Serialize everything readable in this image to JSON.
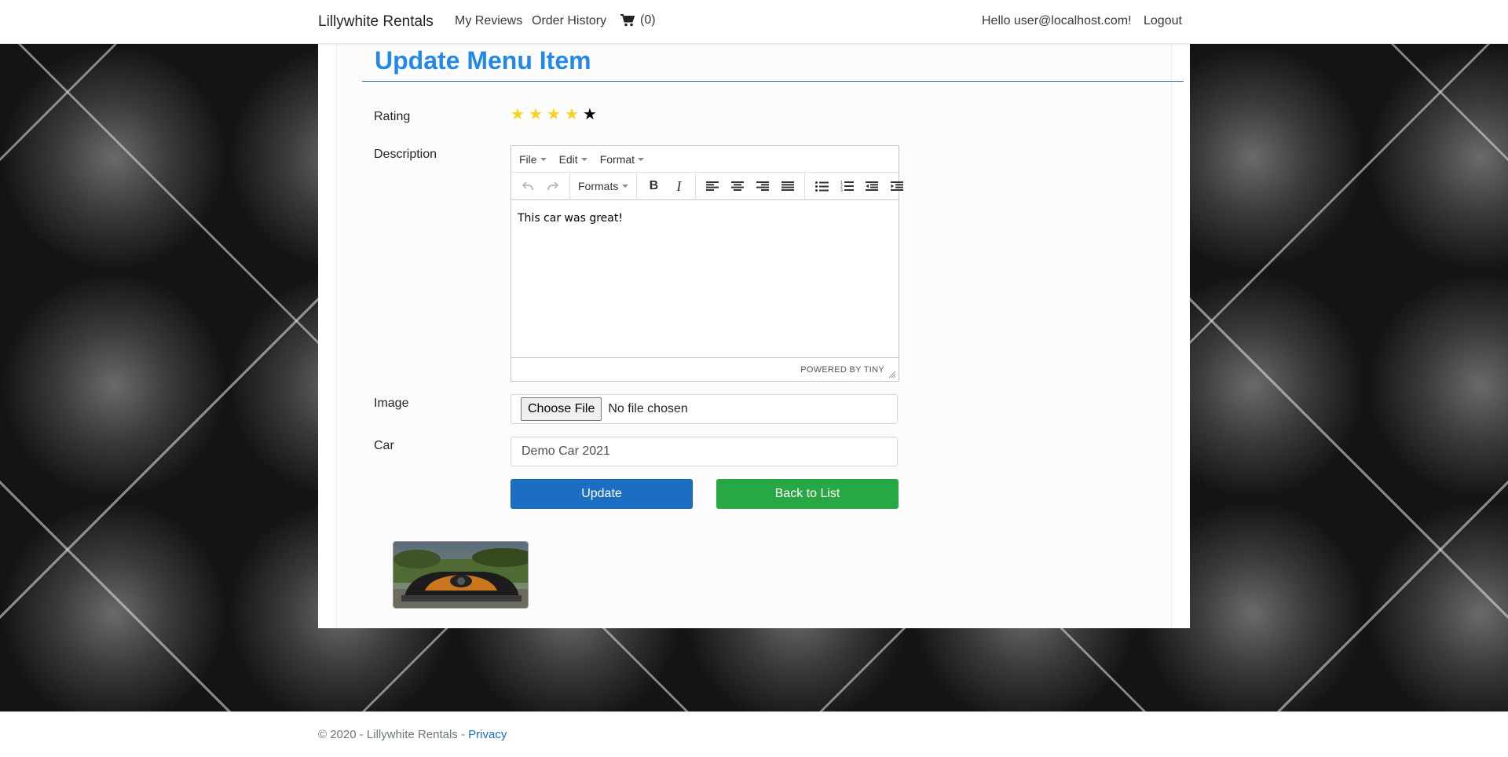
{
  "navbar": {
    "brand": "Lillywhite Rentals",
    "my_reviews": "My Reviews",
    "order_history": "Order History",
    "cart_count": "(0)",
    "greeting": "Hello user@localhost.com!",
    "logout": "Logout"
  },
  "page": {
    "title": "Update Menu Item"
  },
  "form": {
    "rating_label": "Rating",
    "rating_value": 4,
    "rating_max": 5,
    "star_filled_color": "#f8d31b",
    "star_empty_color": "#000000",
    "description_label": "Description",
    "image_label": "Image",
    "car_label": "Car",
    "choose_file": "Choose File",
    "no_file": "No file chosen",
    "car_value": "Demo Car 2021",
    "update_button": "Update",
    "back_button": "Back to List"
  },
  "editor": {
    "menu": [
      "File",
      "Edit",
      "Format"
    ],
    "formats_label": "Formats",
    "content": "This car was great!",
    "branding": "POWERED BY TINY"
  },
  "footer": {
    "copyright": "© 2020 - Lillywhite Rentals - ",
    "privacy": "Privacy"
  },
  "colors": {
    "title": "#2488e8",
    "primary": "#1b6ec2",
    "success": "#28a745"
  }
}
